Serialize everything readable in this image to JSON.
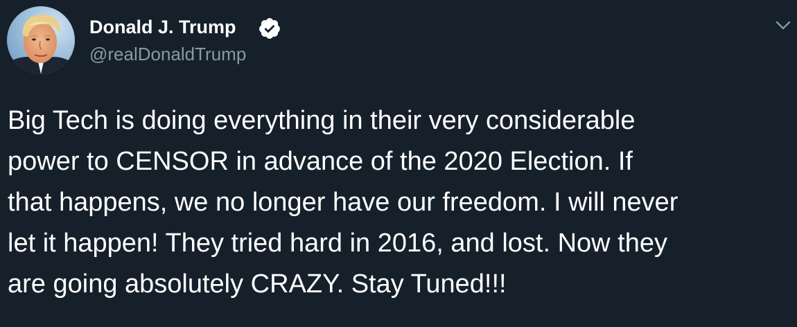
{
  "author": {
    "name": "Donald J. Trump",
    "handle": "@realDonaldTrump",
    "verified": true
  },
  "tweet": {
    "lines": [
      "Big Tech is doing everything in their very considerable",
      "power to CENSOR in advance of the 2020 Election. If",
      "that happens, we no longer have our freedom. I will never",
      "let it happen! They tried hard in 2016, and lost. Now they",
      "are going absolutely CRAZY. Stay Tuned!!!"
    ]
  },
  "icons": {
    "avatar": "profile-photo",
    "verified": "verified-check-icon",
    "menu": "chevron-down-icon"
  },
  "colors": {
    "background": "#15202b",
    "text": "#ffffff",
    "secondary_text": "#8899a6",
    "verified_badge": "#ffffff",
    "verified_check": "#15202b"
  }
}
